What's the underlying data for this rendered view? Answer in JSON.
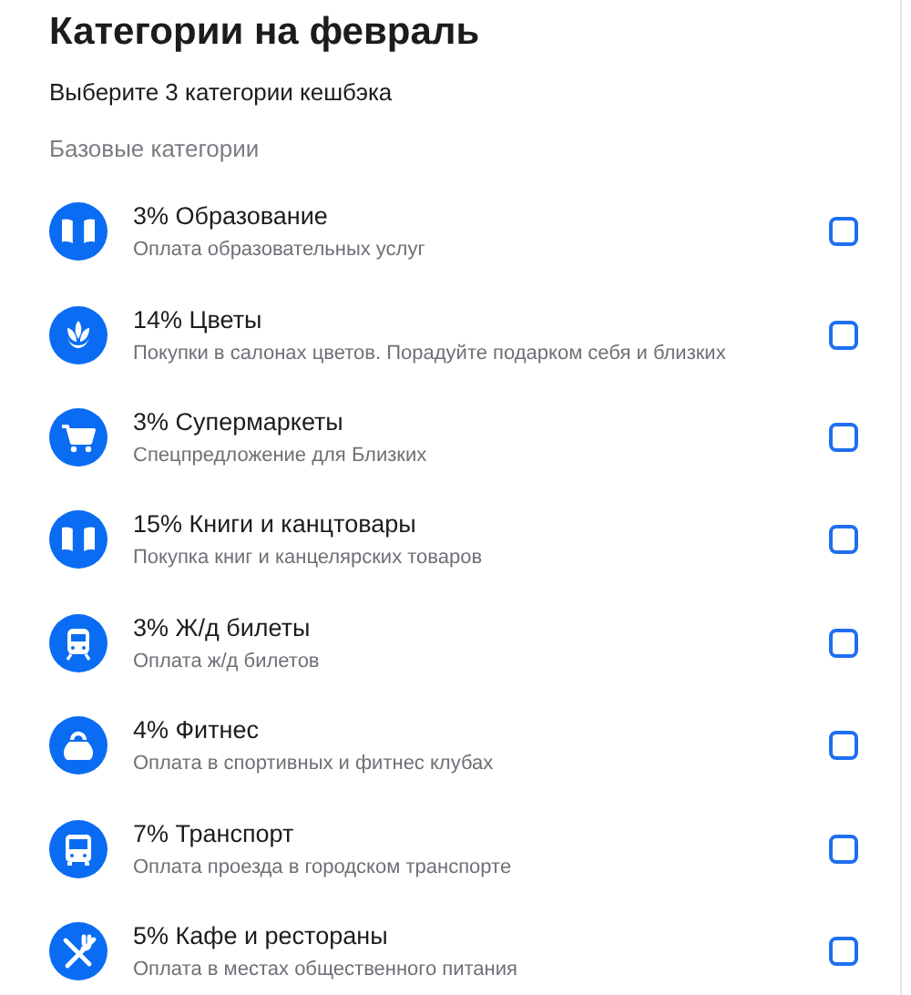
{
  "title": "Категории на февраль",
  "subtitle": "Выберите 3 категории кешбэка",
  "section": "Базовые категории",
  "categories": [
    {
      "name": "3% Образование",
      "description": "Оплата образовательных услуг",
      "checked": false
    },
    {
      "name": "14% Цветы",
      "description": "Покупки в салонах цветов. Порадуйте подарком себя и близких",
      "checked": false
    },
    {
      "name": "3% Супермаркеты",
      "description": "Спецпредложение для Близких",
      "checked": false
    },
    {
      "name": "15% Книги и канцтовары",
      "description": "Покупка книг и канцелярских товаров",
      "checked": false
    },
    {
      "name": "3% Ж/д билеты",
      "description": "Оплата ж/д билетов",
      "checked": false
    },
    {
      "name": "4% Фитнес",
      "description": "Оплата в спортивных и фитнес клубах",
      "checked": false
    },
    {
      "name": "7% Транспорт",
      "description": "Оплата проезда в городском транспорте",
      "checked": false
    },
    {
      "name": "5% Кафе и рестораны",
      "description": "Оплата в местах общественного питания",
      "checked": false
    }
  ]
}
